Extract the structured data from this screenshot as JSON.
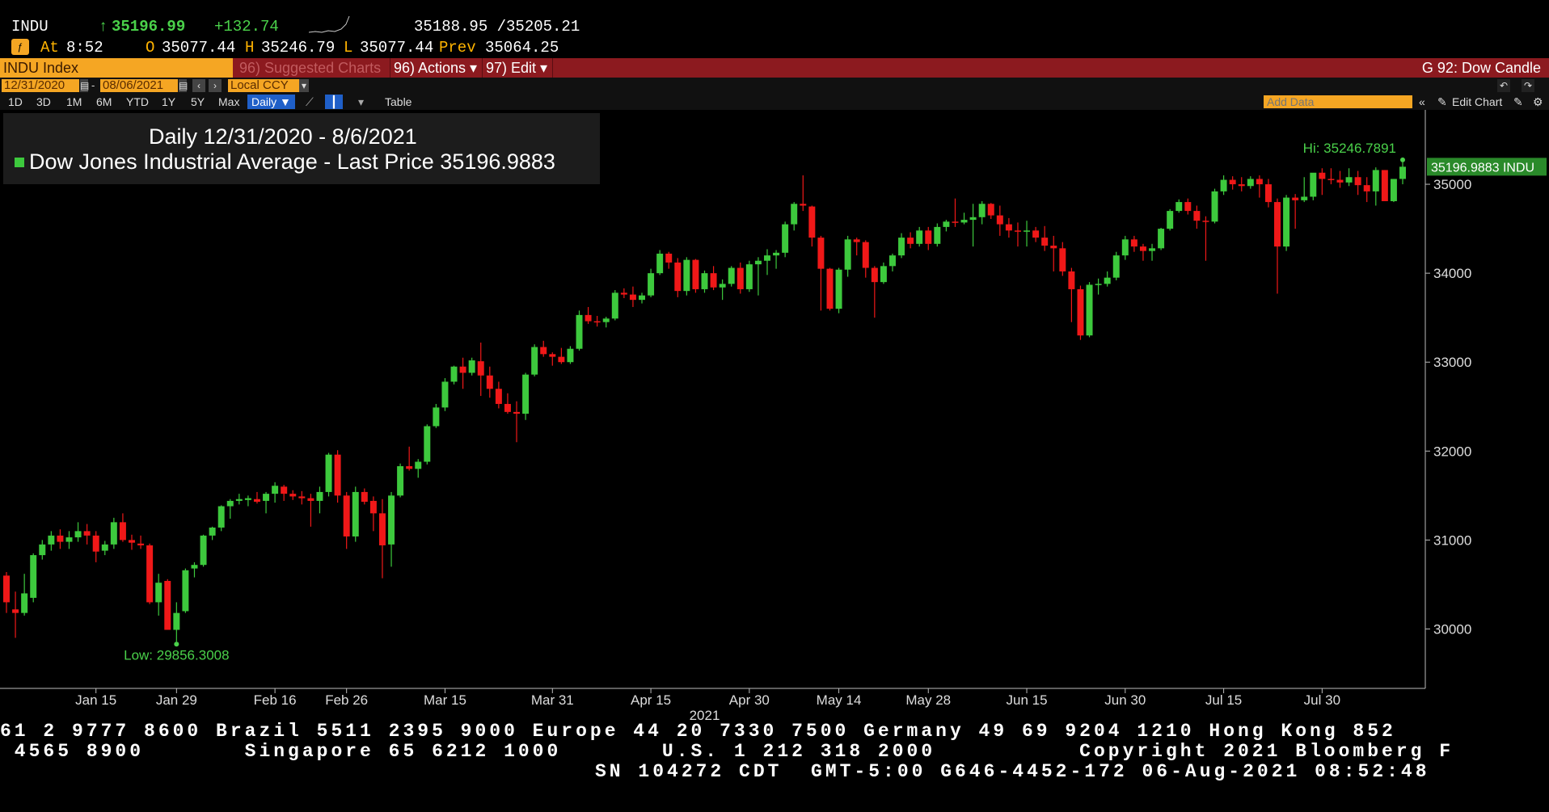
{
  "quote": {
    "ticker": "INDU",
    "arrow": "↑",
    "last": "35196.99",
    "change": "+132.74",
    "bid_ask": "35188.95 /35205.21",
    "at_label": "At",
    "time": "8:52",
    "open_label": "O",
    "open": "35077.44",
    "high_label": "H",
    "high": "35246.79",
    "low_label": "L",
    "low": "35077.44",
    "prev_label": "Prev",
    "prev": "35064.25"
  },
  "toolbar": {
    "security": "INDU Index",
    "suggested": "96) Suggested Charts",
    "actions": "96) Actions ▾",
    "edit": "97) Edit ▾",
    "chart_name": "G 92: Dow Candle"
  },
  "dates": {
    "start": "12/31/2020",
    "end": "08/06/2021",
    "currency": "Local CCY",
    "add_data_placeholder": "Add Data",
    "edit_chart": "Edit Chart"
  },
  "ranges": [
    "1D",
    "3D",
    "1M",
    "6M",
    "YTD",
    "1Y",
    "5Y",
    "Max"
  ],
  "period": "Daily ▼",
  "table_label": "Table",
  "colors": {
    "up": "#3dc93d",
    "down": "#f01818",
    "accent": "#f5a623",
    "bar": "#8c1a1f",
    "label_green": "#4ad14a"
  },
  "chart_data": {
    "type": "candlestick",
    "title": "Daily 12/31/2020 - 8/6/2021",
    "legend": "Dow Jones Industrial Average - Last Price",
    "legend_value": "35196.9883",
    "last_tag": "35196.9883 INDU",
    "hi_label": "Hi: 35246.7891",
    "low_label": "Low: 29856.3008",
    "year_label": "2021",
    "ylim": [
      29350,
      35800
    ],
    "y_ticks": [
      30000,
      31000,
      32000,
      33000,
      34000,
      35000
    ],
    "x_ticks": [
      {
        "label": "Jan 15",
        "i": 10
      },
      {
        "label": "Jan 29",
        "i": 19
      },
      {
        "label": "Feb 16",
        "i": 30
      },
      {
        "label": "Feb 26",
        "i": 38
      },
      {
        "label": "Mar 15",
        "i": 49
      },
      {
        "label": "Mar 31",
        "i": 61
      },
      {
        "label": "Apr 15",
        "i": 72
      },
      {
        "label": "Apr 30",
        "i": 83
      },
      {
        "label": "May 14",
        "i": 93
      },
      {
        "label": "May 28",
        "i": 103
      },
      {
        "label": "Jun 15",
        "i": 114
      },
      {
        "label": "Jun 30",
        "i": 125
      },
      {
        "label": "Jul 15",
        "i": 136
      },
      {
        "label": "Jul 30",
        "i": 147
      }
    ],
    "ohlc": [
      [
        30600,
        30640,
        30180,
        30300
      ],
      [
        30220,
        30420,
        29900,
        30180
      ],
      [
        30180,
        30620,
        30150,
        30400
      ],
      [
        30350,
        30850,
        30300,
        30830
      ],
      [
        30830,
        31000,
        30780,
        30950
      ],
      [
        30950,
        31100,
        30880,
        31050
      ],
      [
        31050,
        31120,
        30900,
        30980
      ],
      [
        30980,
        31100,
        30900,
        31030
      ],
      [
        31030,
        31200,
        30980,
        31100
      ],
      [
        31100,
        31180,
        30950,
        31050
      ],
      [
        31050,
        31100,
        30750,
        30870
      ],
      [
        30880,
        30990,
        30830,
        30950
      ],
      [
        30950,
        31250,
        30900,
        31200
      ],
      [
        31200,
        31300,
        30980,
        31000
      ],
      [
        31000,
        31060,
        30890,
        30970
      ],
      [
        30960,
        31050,
        30900,
        30940
      ],
      [
        30940,
        30960,
        30280,
        30300
      ],
      [
        30300,
        30620,
        30150,
        30520
      ],
      [
        30540,
        30560,
        30000,
        29990
      ],
      [
        29990,
        30300,
        29856,
        30180
      ],
      [
        30200,
        30680,
        30180,
        30660
      ],
      [
        30680,
        30750,
        30580,
        30720
      ],
      [
        30720,
        31060,
        30700,
        31050
      ],
      [
        31050,
        31150,
        31000,
        31140
      ],
      [
        31140,
        31390,
        31100,
        31380
      ],
      [
        31380,
        31460,
        31240,
        31440
      ],
      [
        31440,
        31520,
        31400,
        31460
      ],
      [
        31450,
        31500,
        31380,
        31470
      ],
      [
        31460,
        31540,
        31410,
        31430
      ],
      [
        31440,
        31540,
        31300,
        31520
      ],
      [
        31520,
        31650,
        31420,
        31610
      ],
      [
        31600,
        31620,
        31440,
        31520
      ],
      [
        31520,
        31560,
        31450,
        31490
      ],
      [
        31490,
        31550,
        31400,
        31470
      ],
      [
        31470,
        31520,
        31150,
        31440
      ],
      [
        31440,
        31600,
        31300,
        31540
      ],
      [
        31540,
        31980,
        31490,
        31960
      ],
      [
        31960,
        32010,
        31420,
        31500
      ],
      [
        31500,
        31540,
        30900,
        31040
      ],
      [
        31040,
        31600,
        30980,
        31540
      ],
      [
        31540,
        31580,
        31400,
        31430
      ],
      [
        31440,
        31490,
        31100,
        31300
      ],
      [
        31300,
        31460,
        30570,
        30940
      ],
      [
        30950,
        31540,
        30700,
        31500
      ],
      [
        31500,
        31860,
        31480,
        31830
      ],
      [
        31830,
        32050,
        31780,
        31800
      ],
      [
        31800,
        31910,
        31700,
        31880
      ],
      [
        31880,
        32300,
        31850,
        32280
      ],
      [
        32280,
        32530,
        32260,
        32490
      ],
      [
        32490,
        32820,
        32450,
        32780
      ],
      [
        32780,
        32960,
        32750,
        32950
      ],
      [
        32950,
        33050,
        32700,
        32880
      ],
      [
        32880,
        33050,
        32850,
        33020
      ],
      [
        33010,
        33220,
        32620,
        32850
      ],
      [
        32850,
        32950,
        32600,
        32700
      ],
      [
        32700,
        32780,
        32480,
        32530
      ],
      [
        32530,
        32650,
        32420,
        32440
      ],
      [
        32440,
        32560,
        32100,
        32420
      ],
      [
        32420,
        32880,
        32350,
        32860
      ],
      [
        32860,
        33200,
        32840,
        33170
      ],
      [
        33170,
        33240,
        33060,
        33090
      ],
      [
        33090,
        33110,
        32960,
        33060
      ],
      [
        33060,
        33160,
        32980,
        33000
      ],
      [
        33000,
        33180,
        32980,
        33150
      ],
      [
        33150,
        33580,
        33130,
        33530
      ],
      [
        33530,
        33620,
        33430,
        33460
      ],
      [
        33460,
        33520,
        33400,
        33450
      ],
      [
        33450,
        33510,
        33390,
        33490
      ],
      [
        33490,
        33810,
        33470,
        33780
      ],
      [
        33780,
        33830,
        33720,
        33760
      ],
      [
        33760,
        33850,
        33620,
        33700
      ],
      [
        33700,
        33780,
        33660,
        33750
      ],
      [
        33750,
        34050,
        33730,
        34000
      ],
      [
        34000,
        34260,
        33980,
        34220
      ],
      [
        34220,
        34240,
        34050,
        34120
      ],
      [
        34120,
        34170,
        33730,
        33800
      ],
      [
        33800,
        34180,
        33750,
        34150
      ],
      [
        34150,
        34160,
        33780,
        33820
      ],
      [
        33820,
        34030,
        33780,
        34000
      ],
      [
        34000,
        34080,
        33810,
        33840
      ],
      [
        33840,
        33930,
        33700,
        33880
      ],
      [
        33880,
        34080,
        33850,
        34060
      ],
      [
        34060,
        34120,
        33770,
        33820
      ],
      [
        33820,
        34140,
        33790,
        34100
      ],
      [
        34100,
        34180,
        33750,
        34140
      ],
      [
        34140,
        34270,
        33980,
        34200
      ],
      [
        34200,
        34260,
        34050,
        34230
      ],
      [
        34230,
        34580,
        34180,
        34550
      ],
      [
        34550,
        34800,
        34480,
        34780
      ],
      [
        34780,
        35100,
        34700,
        34760
      ],
      [
        34750,
        34760,
        34300,
        34400
      ],
      [
        34400,
        34420,
        33580,
        34050
      ],
      [
        34050,
        34060,
        33580,
        33600
      ],
      [
        33600,
        34060,
        33550,
        34040
      ],
      [
        34040,
        34420,
        33960,
        34380
      ],
      [
        34380,
        34400,
        34200,
        34350
      ],
      [
        34350,
        34370,
        33950,
        34060
      ],
      [
        34060,
        34080,
        33500,
        33900
      ],
      [
        33900,
        34120,
        33880,
        34080
      ],
      [
        34080,
        34220,
        34020,
        34200
      ],
      [
        34200,
        34450,
        34170,
        34400
      ],
      [
        34400,
        34460,
        34280,
        34330
      ],
      [
        34330,
        34520,
        34300,
        34480
      ],
      [
        34480,
        34520,
        34260,
        34330
      ],
      [
        34330,
        34560,
        34300,
        34520
      ],
      [
        34520,
        34600,
        34470,
        34580
      ],
      [
        34580,
        34840,
        34520,
        34570
      ],
      [
        34570,
        34680,
        34550,
        34600
      ],
      [
        34600,
        34780,
        34300,
        34630
      ],
      [
        34630,
        34810,
        34550,
        34780
      ],
      [
        34780,
        34790,
        34610,
        34650
      ],
      [
        34650,
        34760,
        34420,
        34550
      ],
      [
        34550,
        34620,
        34400,
        34480
      ],
      [
        34480,
        34570,
        34300,
        34470
      ],
      [
        34470,
        34590,
        34300,
        34480
      ],
      [
        34480,
        34520,
        34350,
        34400
      ],
      [
        34400,
        34530,
        34250,
        34310
      ],
      [
        34310,
        34420,
        34020,
        34280
      ],
      [
        34280,
        34350,
        33970,
        34020
      ],
      [
        34020,
        34060,
        33450,
        33820
      ],
      [
        33820,
        33860,
        33250,
        33300
      ],
      [
        33300,
        33900,
        33280,
        33870
      ],
      [
        33870,
        33940,
        33760,
        33880
      ],
      [
        33880,
        34020,
        33850,
        33950
      ],
      [
        33950,
        34240,
        33920,
        34200
      ],
      [
        34200,
        34420,
        34150,
        34380
      ],
      [
        34380,
        34420,
        34240,
        34300
      ],
      [
        34300,
        34330,
        34140,
        34250
      ],
      [
        34250,
        34330,
        34140,
        34280
      ],
      [
        34280,
        34510,
        34260,
        34500
      ],
      [
        34500,
        34720,
        34480,
        34700
      ],
      [
        34700,
        34830,
        34680,
        34800
      ],
      [
        34800,
        34840,
        34660,
        34700
      ],
      [
        34700,
        34760,
        34500,
        34590
      ],
      [
        34590,
        34640,
        34140,
        34580
      ],
      [
        34580,
        34950,
        34560,
        34920
      ],
      [
        34920,
        35100,
        34880,
        35050
      ],
      [
        35050,
        35090,
        34940,
        35000
      ],
      [
        35000,
        35080,
        34920,
        34980
      ],
      [
        34980,
        35090,
        34950,
        35060
      ],
      [
        35060,
        35100,
        34850,
        35000
      ],
      [
        35000,
        35060,
        34740,
        34800
      ],
      [
        34800,
        34840,
        33770,
        34300
      ],
      [
        34300,
        34880,
        34250,
        34850
      ],
      [
        34850,
        34890,
        34500,
        34820
      ],
      [
        34820,
        35080,
        34800,
        34860
      ],
      [
        34860,
        35100,
        34820,
        35130
      ],
      [
        35130,
        35180,
        34880,
        35060
      ],
      [
        35060,
        35180,
        35000,
        35050
      ],
      [
        35050,
        35150,
        34960,
        35020
      ],
      [
        35020,
        35180,
        34980,
        35080
      ],
      [
        35080,
        35150,
        34880,
        34990
      ],
      [
        34990,
        35080,
        34800,
        34920
      ],
      [
        34920,
        35190,
        34760,
        35160
      ],
      [
        35160,
        35160,
        34830,
        34810
      ],
      [
        34810,
        35050,
        34800,
        35060
      ],
      [
        35060,
        35247,
        35000,
        35197
      ]
    ]
  },
  "footer": {
    "line1": "61 2 9777 8600 Brazil 5511 2395 9000 Europe 44 20 7330 7500 Germany 49 69 9204 1210 Hong Kong 852",
    "line2": " 4565 8900       Singapore 65 6212 1000       U.S. 1 212 318 2000          Copyright 2021 Bloomberg F",
    "line3": "SN 104272 CDT  GMT-5:00 G646-4452-172 06-Aug-2021 08:52:48"
  }
}
